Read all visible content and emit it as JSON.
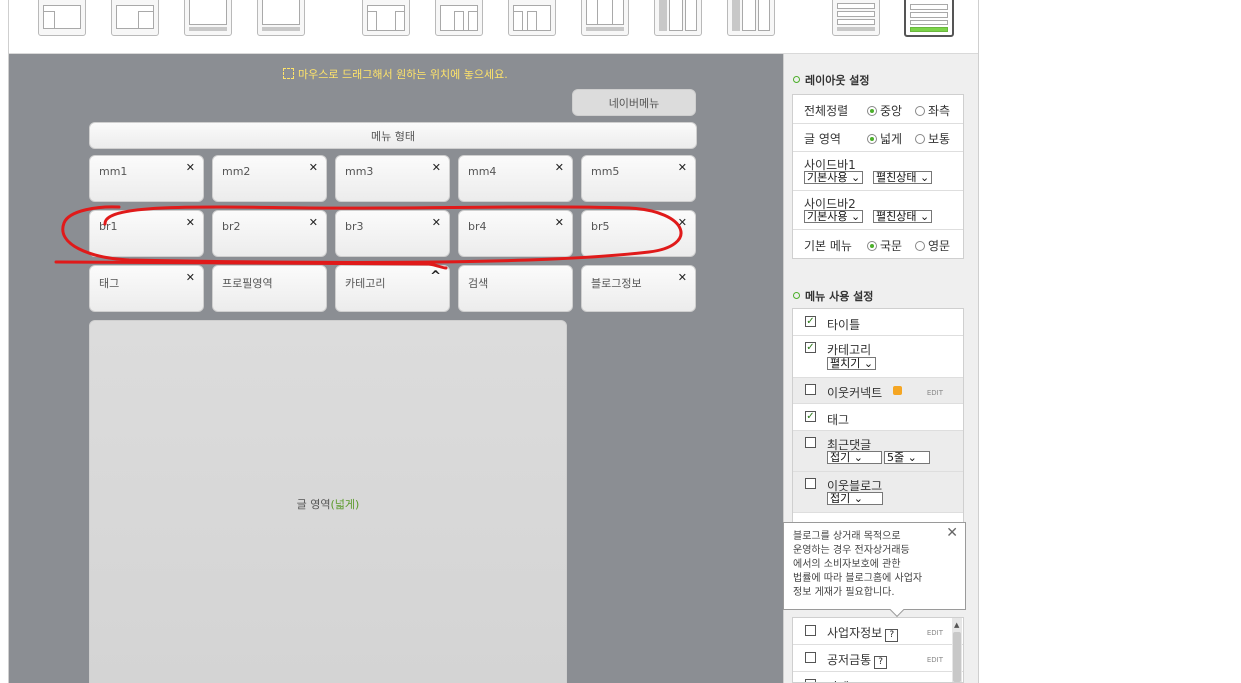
{
  "canvas": {
    "hint": "마우스로 드래그해서 원하는 위치에 놓으세요.",
    "naver_menu": "네이버메뉴",
    "menu_form": "메뉴 형태",
    "row_mm": [
      "mm1",
      "mm2",
      "mm3",
      "mm4",
      "mm5"
    ],
    "row_br": [
      "br1",
      "br2",
      "br3",
      "br4",
      "br5"
    ],
    "row_widgets": [
      "태그",
      "프로필영역",
      "카테고리",
      "검색",
      "블로그정보"
    ],
    "content_area": {
      "label": "글 영역",
      "suffix": "(넓게)"
    },
    "annotation_color": "#e01a1a"
  },
  "panel": {
    "layout_title": "레이아웃 설정",
    "layout": {
      "align": {
        "label": "전체정렬",
        "opt1": "중앙",
        "opt2": "좌측"
      },
      "text_area": {
        "label": "글 영역",
        "opt1": "넓게",
        "opt2": "보통"
      },
      "sidebar1": {
        "label": "사이드바1",
        "sel1": "기본사용",
        "sel2": "펼친상태"
      },
      "sidebar2": {
        "label": "사이드바2",
        "sel1": "기본사용",
        "sel2": "펼친상태"
      },
      "basic_menu": {
        "label": "기본 메뉴",
        "opt1": "국문",
        "opt2": "영문"
      }
    },
    "menu_title": "메뉴 사용 설정",
    "menu_items": {
      "title": "타이틀",
      "category": "카테고리",
      "category_sel": "펼치기",
      "neighbor_connect": "이웃커넥트",
      "edit": "EDIT",
      "tag": "태그",
      "recent_comments": "최근댓글",
      "recent_sel1": "접기",
      "recent_sel2": "5줄",
      "neighbor_blog": "이웃블로그",
      "neighbor_sel": "접기",
      "business_info": "사업자정보",
      "business_edit": "EDIT",
      "public_fund": "공저금통",
      "public_edit": "EDIT",
      "partial": "타겟"
    },
    "tooltip": "블로그를 상거래 목적으로 운영하는 경우 전자상거래등 에서의 소비자보호에 관한 법률에 따라 블로그홈에 사업자 정보 게재가 필요합니다.",
    "tooltip_lines": [
      "블로그를 상거래 목적으로",
      "운영하는 경우 전자상거래등",
      "에서의 소비자보호에 관한",
      "법률에 따라 블로그홈에 사업자",
      "정보 게재가 필요합니다."
    ]
  },
  "colors": {
    "accent_green": "#4caf2a",
    "canvas_bg": "#8b8e93",
    "hint_yellow": "#ffe46a"
  },
  "icons": [
    "layout-thumbnail-icon",
    "close-icon",
    "collapse-icon",
    "drag-icon",
    "question-icon",
    "new-badge-icon"
  ]
}
